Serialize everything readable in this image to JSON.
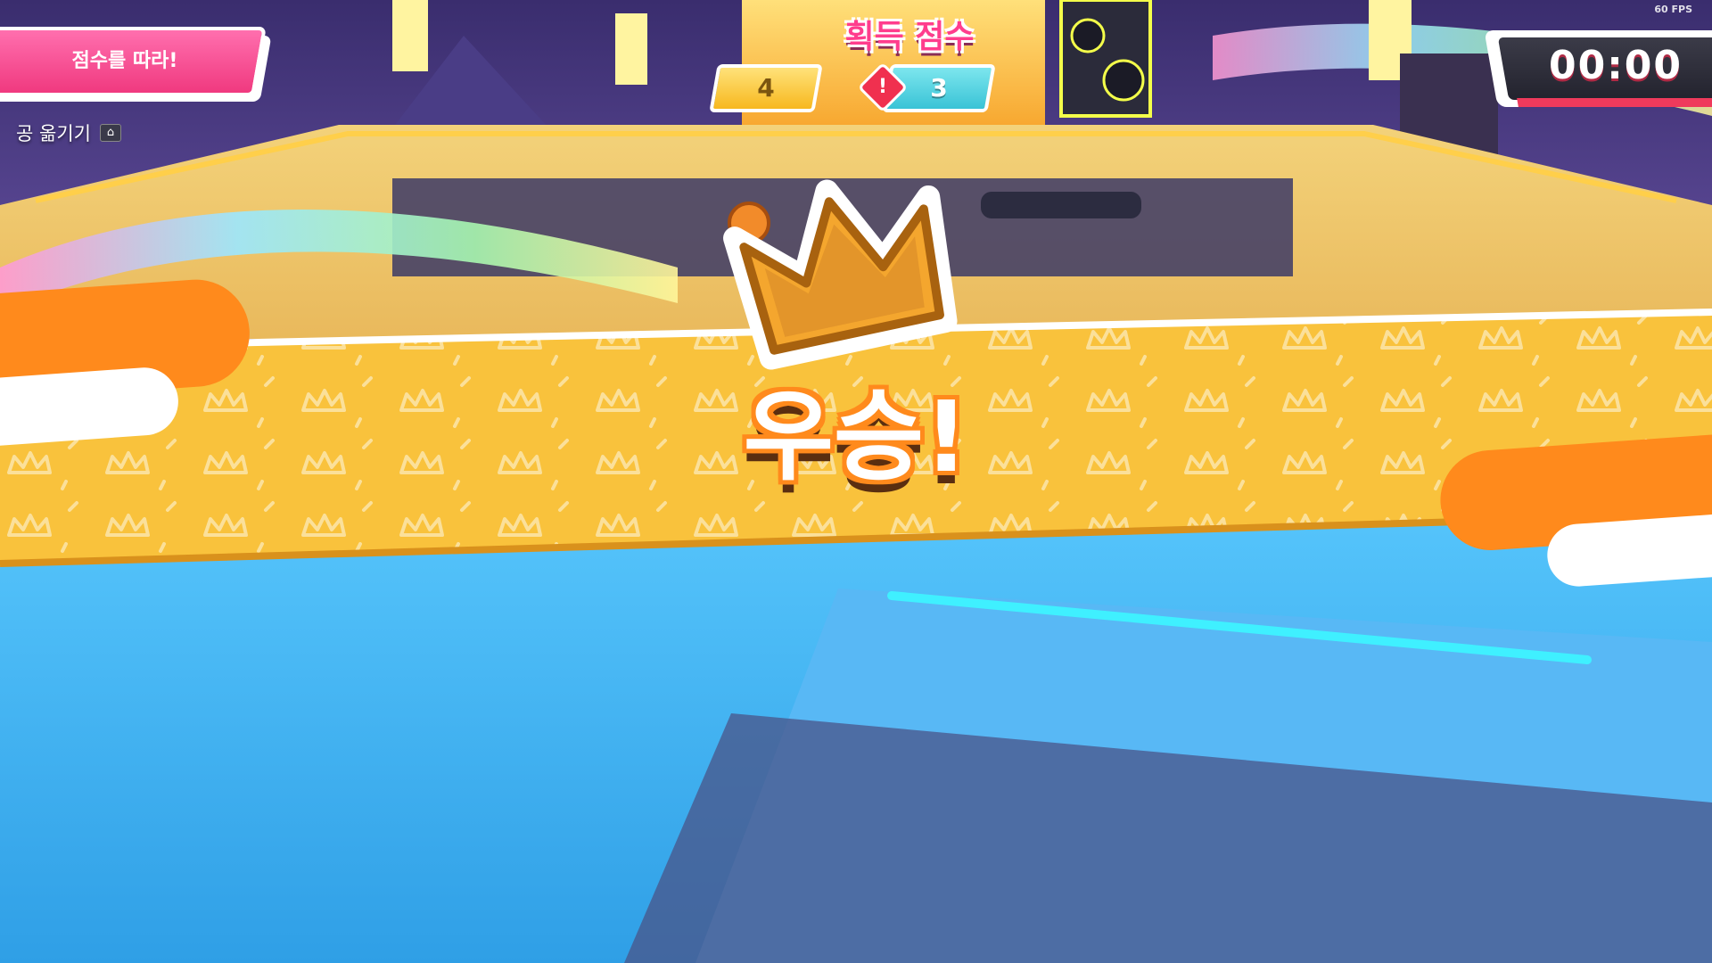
{
  "hud": {
    "fps": "60 FPS",
    "round_name": "점수를 따라!",
    "hint": {
      "label": "공 옮기기",
      "key_icon": "home-key-icon",
      "key_glyph": "⌂"
    },
    "score_title": "획득 점수",
    "scores": {
      "left": "4",
      "right": "3",
      "alert_glyph": "!"
    },
    "timer": "00:00"
  },
  "banner": {
    "victory_text": "우승!",
    "icon": "crown-icon"
  },
  "colors": {
    "banner_yellow": "#f9c23c",
    "accent_orange": "#ff8a1c",
    "pink": "#f0397f",
    "team_yellow": "#f7b81e",
    "team_cyan": "#39c3d6",
    "floor_blue": "#45b4f2"
  }
}
